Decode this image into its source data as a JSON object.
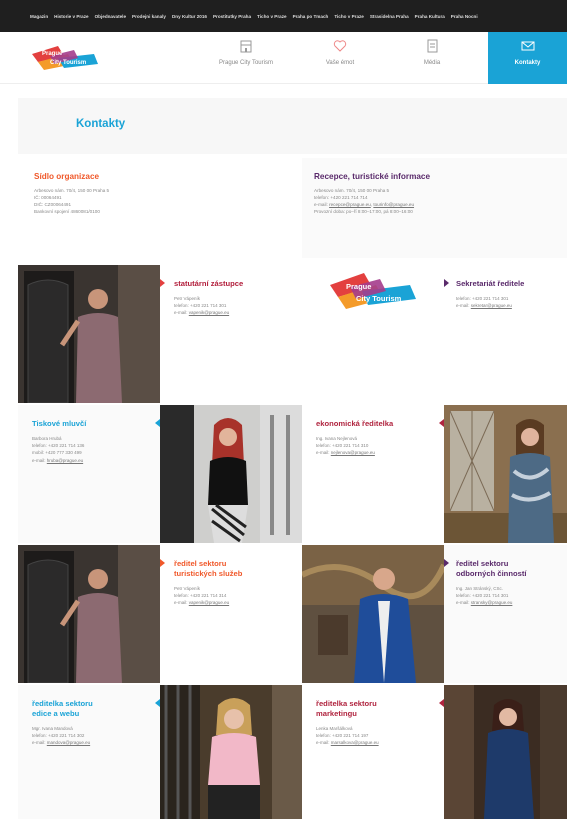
{
  "topbar": {
    "links": [
      "Magazin",
      "Historie v Praze",
      "Objednavatele",
      "Prodejni kanaly",
      "Dny Kultur 2016",
      "Prostitutky Praha",
      "Ticho v Praze",
      "Praha po Tmach",
      "Ticho v Praze",
      "Strasidelna Praha",
      "Praha Kultura",
      "Praha Nocni"
    ]
  },
  "header": {
    "logo_text_line1": "Prague",
    "logo_text_line2": "City Tourism",
    "nav": [
      {
        "label": "Prague City Tourism",
        "icon": "building-icon"
      },
      {
        "label": "Vaše émot",
        "icon": "heart-icon"
      },
      {
        "label": "Média",
        "icon": "document-icon"
      }
    ],
    "active": {
      "label": "Kontakty",
      "icon": "envelope-icon"
    }
  },
  "page": {
    "title": "Kontakty"
  },
  "sidlo": {
    "title": "Sídlo organizace",
    "lines": [
      "Arbesovo nám. 70/4, 150 00 Praha 5",
      "IČ: 00064491",
      "DIČ: CZ00064491",
      "Bankovní spojení 4860081/0100"
    ]
  },
  "recepce": {
    "title": "Recepce, turistické informace",
    "lines": [
      "Arbesovo nám. 70/4, 150 00 Praha 5",
      "telefon: +420 221 714 714"
    ],
    "email_label": "e-mail:",
    "email_links": [
      "recepce@prague.eu",
      "tourinfo@prague.eu"
    ],
    "hours": "Provozní doba: po–ří 8:00–17:00, pá 8:00–16:00"
  },
  "cards": [
    {
      "title": "statutární zástupce",
      "name": "Petr Vápeník",
      "phone": "telefon: +420 221 714 301",
      "email_label": "e-mail:",
      "email": "vapenik@prague.eu"
    },
    {
      "title": "Sekretariát ředitele",
      "name": "",
      "phone": "telefon: +420 221 714 301",
      "email_label": "e-mail:",
      "email": "sekretar@prague.eu"
    },
    {
      "title": "Tiskové mluvčí",
      "name": "Barbora Hrubá",
      "phone": "telefon: +420 221 714 136",
      "mobile": "mobil: +420 777 330 499",
      "email_label": "e-mail:",
      "email": "hruba@prague.eu"
    },
    {
      "title": "ekonomická ředitelka",
      "name": "Ing. Ivana Nejlenová",
      "phone": "telefon: +420 221 714 310",
      "email_label": "e-mail:",
      "email": "nejlenova@prague.eu"
    },
    {
      "title_line1": "ředitel sektoru",
      "title_line2": "turistických služeb",
      "name": "Petr Vápeník",
      "phone": "telefon: +420 221 714 314",
      "email_label": "e-mail:",
      "email": "vapenik@prague.eu"
    },
    {
      "title_line1": "ředitel sektoru",
      "title_line2": "odborných činností",
      "name": "Ing. Jan Stránský, CSc.",
      "phone": "telefon: +420 221 714 301",
      "email_label": "e-mail:",
      "email": "stransky@prague.eu"
    },
    {
      "title_line1": "ředitelka sektoru",
      "title_line2": "edice a webu",
      "name": "Mgr. Ivana Mandová",
      "phone": "telefon: +420 221 714 302",
      "email_label": "e-mail:",
      "email": "mandova@prague.eu"
    },
    {
      "title_line1": "ředitelka sektoru",
      "title_line2": "marketingu",
      "name": "Lenka Maršálková",
      "phone": "telefon: +420 221 714 197",
      "email_label": "e-mail:",
      "email": "marsalkova@prague.eu"
    }
  ],
  "colors": {
    "accent_blue": "#1aa3d6",
    "orange": "#f0582a",
    "purple": "#5a2a6b",
    "crimson": "#b0243f",
    "topbar": "#1f1f1f"
  }
}
